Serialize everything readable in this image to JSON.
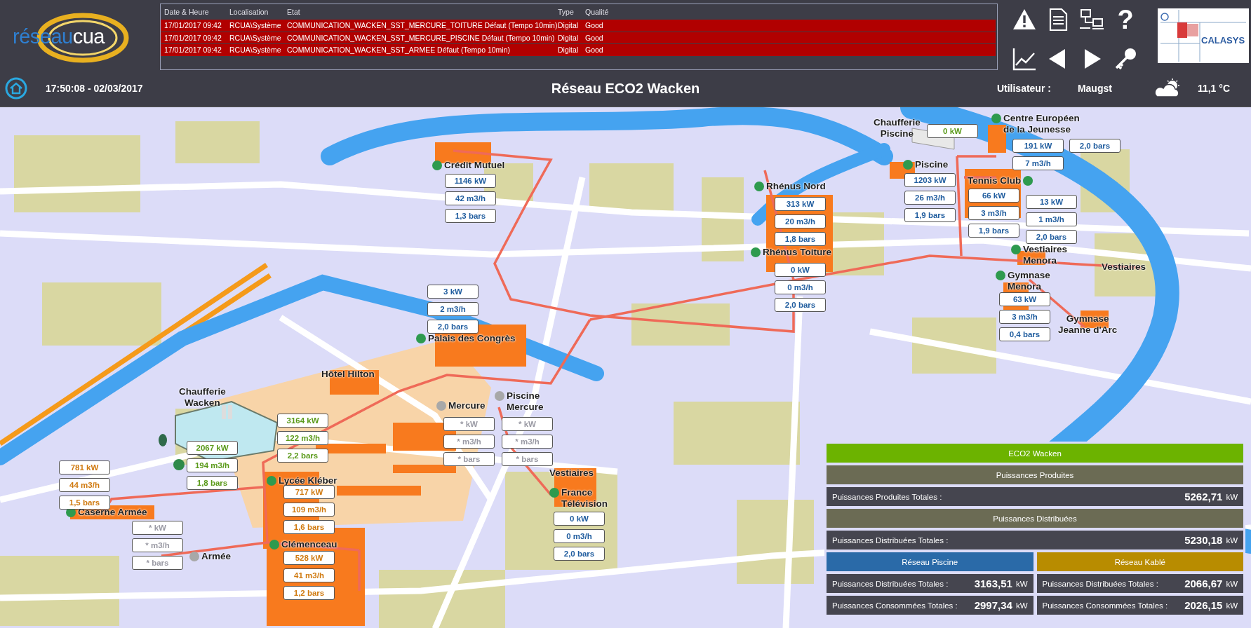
{
  "header": {
    "logo": {
      "word_1": "réseau",
      "word_2": "cua"
    },
    "alarms": {
      "columns": [
        "Date & Heure",
        "Localisation",
        "Etat",
        "Type",
        "Qualité"
      ],
      "rows": [
        {
          "date": "17/01/2017 09:42",
          "location": "RCUA\\Système",
          "state": "COMMUNICATION_WACKEN_SST_MERCURE_TOITURE Défaut (Tempo 10min)",
          "type": "Digital",
          "quality": "Good"
        },
        {
          "date": "17/01/2017 09:42",
          "location": "RCUA\\Système",
          "state": "COMMUNICATION_WACKEN_SST_MERCURE_PISCINE Défaut (Tempo 10min)",
          "type": "Digital",
          "quality": "Good"
        },
        {
          "date": "17/01/2017 09:42",
          "location": "RCUA\\Système",
          "state": "COMMUNICATION_WACKEN_SST_ARMEE Défaut (Tempo 10min)",
          "type": "Digital",
          "quality": "Good"
        }
      ]
    },
    "toolbar": [
      "?"
    ],
    "brand": "CALASYS"
  },
  "status_bar": {
    "datetime": "17:50:08 - 02/03/2017",
    "title": "Réseau ECO2 Wacken",
    "user_label": "Utilisateur :",
    "user": "Maugst",
    "temperature": "11,1 °C"
  },
  "map": {
    "sites": [
      {
        "name": "Crédit Mutuel",
        "color": "#2e9a4e"
      },
      {
        "name": "Rhénus Nord",
        "color": "#2e9a4e"
      },
      {
        "name": "Rhénus Toiture",
        "color": "#2e9a4e"
      },
      {
        "name": "Chaufferie\nPiscine"
      },
      {
        "name": "Centre Européen\nde la Jeunesse",
        "color": "#2e9a4e"
      },
      {
        "name": "Piscine",
        "color": "#2e9a4e"
      },
      {
        "name": "Tennis Club",
        "color": "#2e9a4e"
      },
      {
        "name": "Vestiaires\nMenora",
        "color": "#2e9a4e"
      },
      {
        "name": "Vestiaires"
      },
      {
        "name": "Gymnase\nMenora",
        "color": "#2e9a4e"
      },
      {
        "name": "Gymnase\nJeanne d'Arc"
      },
      {
        "name": "Palais des Congrès",
        "color": "#2e9a4e"
      },
      {
        "name": "Hôtel Hilton"
      },
      {
        "name": "Chaufferie\nWacken"
      },
      {
        "name": "Mercure",
        "color": "#a8a8a8"
      },
      {
        "name": "Piscine\nMercure",
        "color": "#a8a8a8"
      },
      {
        "name": "Lycée Kléber",
        "color": "#2e9a4e"
      },
      {
        "name": "Caserne Armée",
        "color": "#2e9a4e"
      },
      {
        "name": "Armée",
        "color": "#a8a8a8"
      },
      {
        "name": "Clémenceau",
        "color": "#2e9a4e"
      },
      {
        "name": "Vestiaires"
      },
      {
        "name": "France\nTélévision",
        "color": "#2e9a4e"
      }
    ],
    "gauges": [
      {
        "kind": "piscine",
        "values": [
          "1146 kW",
          "42 m3/h",
          "1,3 bars"
        ]
      },
      {
        "kind": "piscine",
        "values": [
          "313 kW",
          "20 m3/h",
          "1,8 bars"
        ]
      },
      {
        "kind": "piscine",
        "values": [
          "0 kW",
          "0 m3/h",
          "2,0 bars"
        ]
      },
      {
        "kind": "production",
        "values": [
          "0 kW"
        ]
      },
      {
        "kind": "piscine",
        "values": [
          "191 kW",
          "7 m3/h"
        ]
      },
      {
        "kind": "piscine",
        "values": [
          "2,0 bars"
        ]
      },
      {
        "kind": "piscine",
        "values": [
          "1203 kW",
          "26 m3/h",
          "1,9 bars"
        ]
      },
      {
        "kind": "piscine",
        "values": [
          "66 kW",
          "3 m3/h",
          "1,9 bars"
        ]
      },
      {
        "kind": "piscine",
        "values": [
          "13 kW",
          "1 m3/h",
          "2,0 bars"
        ]
      },
      {
        "kind": "piscine",
        "values": [
          "63 kW",
          "3 m3/h",
          "0,4 bars"
        ]
      },
      {
        "kind": "piscine",
        "values": [
          "3 kW",
          "2 m3/h",
          "2,0 bars"
        ]
      },
      {
        "kind": "production",
        "values": [
          "3164 kW",
          "122 m3/h",
          "2,2 bars"
        ]
      },
      {
        "kind": "production",
        "values": [
          "2067 kW",
          "194 m3/h",
          "1,8 bars"
        ]
      },
      {
        "kind": "kable",
        "values": [
          "781 kW",
          "44 m3/h",
          "1,5 bars"
        ]
      },
      {
        "kind": "kable",
        "values": [
          "717 kW",
          "109 m3/h",
          "1,6 bars"
        ]
      },
      {
        "kind": "offline",
        "values": [
          "* kW",
          "* m3/h",
          "* bars"
        ]
      },
      {
        "kind": "kable",
        "values": [
          "528 kW",
          "41 m3/h",
          "1,2 bars"
        ]
      },
      {
        "kind": "offline",
        "values": [
          "* kW",
          "* m3/h",
          "* bars"
        ]
      },
      {
        "kind": "offline",
        "values": [
          "* kW",
          "* m3/h",
          "* bars"
        ]
      },
      {
        "kind": "piscine",
        "values": [
          "0 kW",
          "0 m3/h",
          "2,0 bars"
        ]
      }
    ]
  },
  "summary": {
    "title": "ECO2 Wacken",
    "sections": [
      {
        "heading": "Puissances Produites",
        "rows": [
          {
            "label": "Puissances Produites Totales :",
            "value": "5262,71",
            "unit": "kW"
          }
        ]
      },
      {
        "heading": "Puissances Distribuées",
        "rows": [
          {
            "label": "Puissances Distribuées Totales :",
            "value": "5230,18",
            "unit": "kW"
          }
        ]
      }
    ],
    "networks": [
      {
        "heading": "Réseau Piscine",
        "kind": "piscine",
        "rows": [
          {
            "label": "Puissances Distribuées Totales :",
            "value": "3163,51",
            "unit": "kW"
          },
          {
            "label": "Puissances Consommées Totales :",
            "value": "2997,34",
            "unit": "kW"
          }
        ]
      },
      {
        "heading": "Réseau Kablé",
        "kind": "kable",
        "rows": [
          {
            "label": "Puissances Distribuées Totales :",
            "value": "2066,67",
            "unit": "kW"
          },
          {
            "label": "Puissances Consommées Totales :",
            "value": "2026,15",
            "unit": "kW"
          }
        ]
      }
    ]
  }
}
